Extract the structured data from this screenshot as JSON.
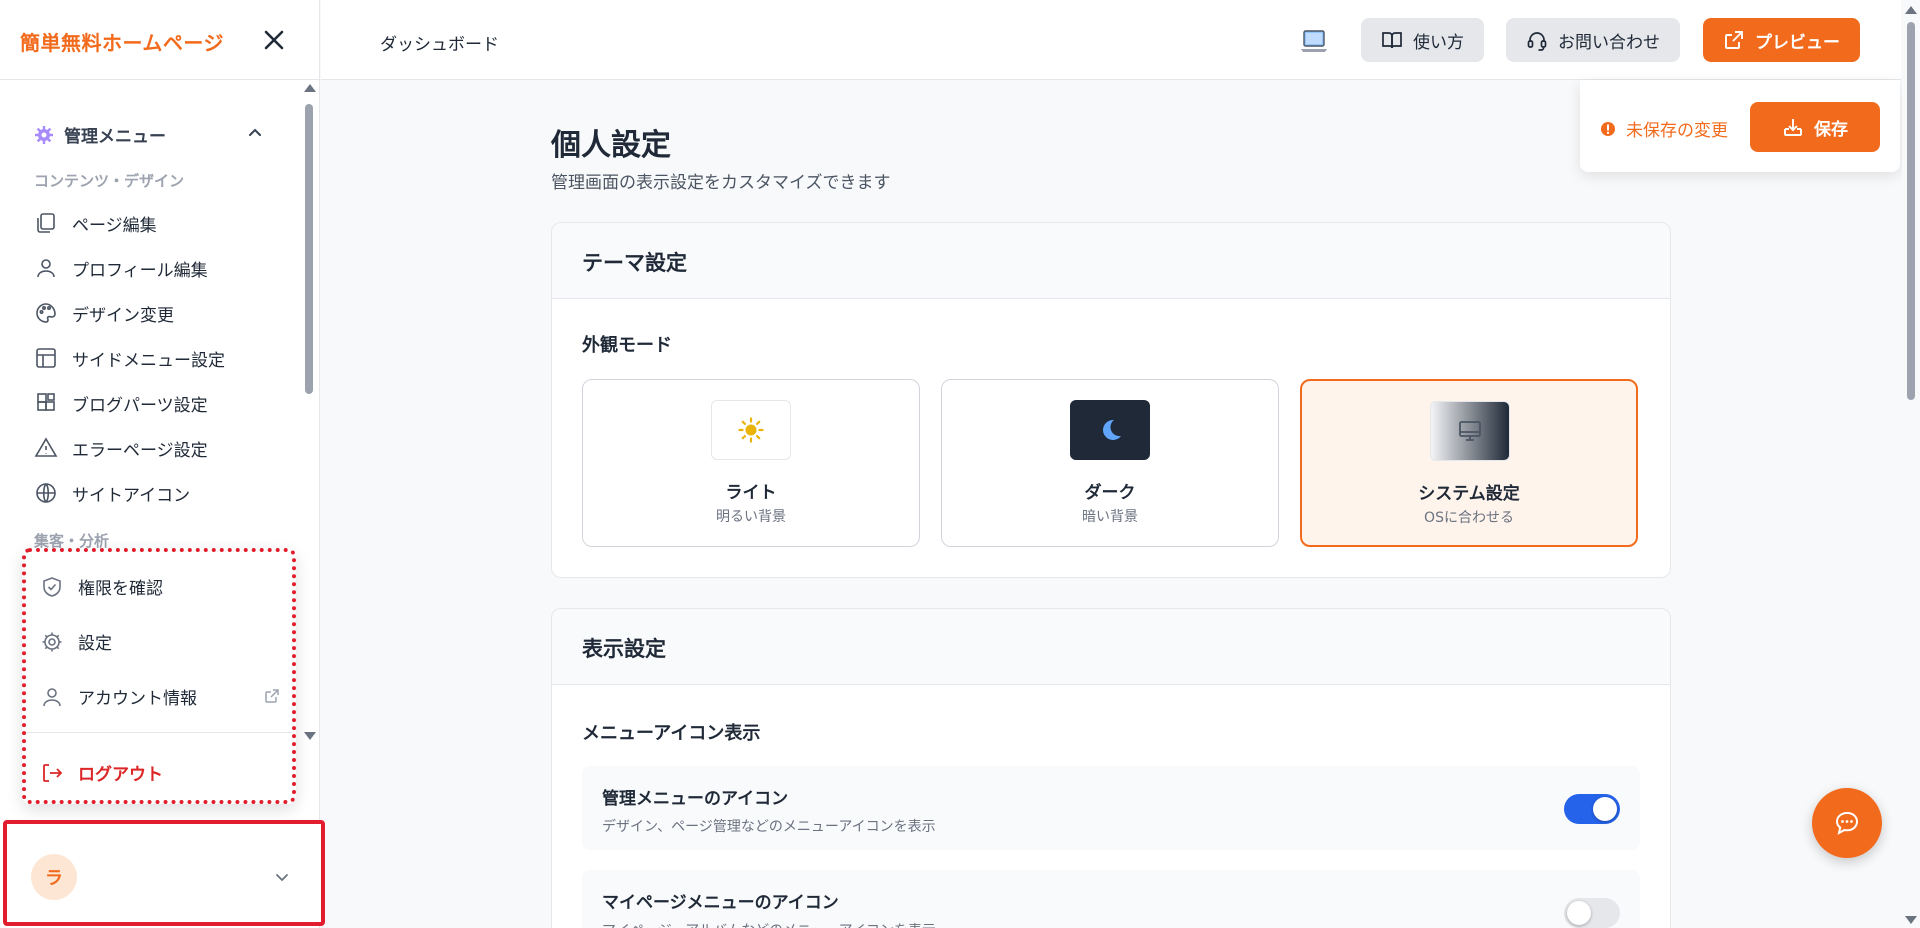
{
  "sidebar": {
    "brand": "簡単無料ホームページ",
    "menu_header": "管理メニュー",
    "section_content": "コンテンツ・デザイン",
    "items": [
      {
        "label": "ページ編集",
        "icon": "copy-icon"
      },
      {
        "label": "プロフィール編集",
        "icon": "user-icon"
      },
      {
        "label": "デザイン変更",
        "icon": "palette-icon"
      },
      {
        "label": "サイドメニュー設定",
        "icon": "layout-icon"
      },
      {
        "label": "ブログパーツ設定",
        "icon": "blocks-icon"
      },
      {
        "label": "エラーページ設定",
        "icon": "warning-icon"
      },
      {
        "label": "サイトアイコン",
        "icon": "globe-icon"
      }
    ],
    "section_analytics": "集客・分析",
    "popup": {
      "permissions": "権限を確認",
      "settings": "設定",
      "account": "アカウント情報",
      "logout": "ログアウト"
    },
    "user_initial": "ラ"
  },
  "topbar": {
    "breadcrumb": "ダッシュボード",
    "howto": "使い方",
    "contact": "お問い合わせ",
    "preview": "プレビュー",
    "unsaved": "未保存の変更",
    "save": "保存"
  },
  "main": {
    "title": "個人設定",
    "subtitle": "管理画面の表示設定をカスタマイズできます",
    "theme": {
      "heading": "テーマ設定",
      "mode_label": "外観モード",
      "options": [
        {
          "name": "ライト",
          "desc": "明るい背景",
          "selected": false
        },
        {
          "name": "ダーク",
          "desc": "暗い背景",
          "selected": false
        },
        {
          "name": "システム設定",
          "desc": "OSに合わせる",
          "selected": true
        }
      ]
    },
    "display": {
      "heading": "表示設定",
      "icon_label": "メニューアイコン表示",
      "rows": [
        {
          "title": "管理メニューのアイコン",
          "desc": "デザイン、ページ管理などのメニューアイコンを表示",
          "on": true
        },
        {
          "title": "マイページメニューのアイコン",
          "desc": "マイページ、アルバムなどのメニューアイコンを表示",
          "on": false
        }
      ]
    }
  },
  "colors": {
    "accent": "#f26b1d",
    "toggle_on": "#2563eb",
    "highlight": "#e11d2e"
  }
}
